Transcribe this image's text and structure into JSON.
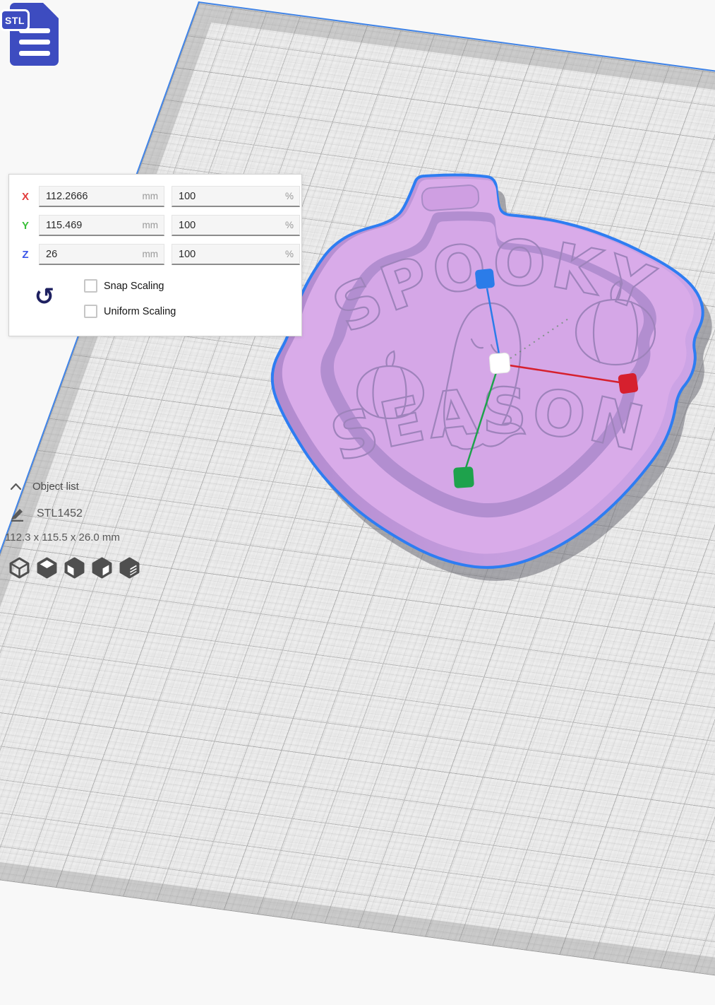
{
  "viewport": {
    "background": "#f8f8f8",
    "plate_edge_color": "#3e83e8",
    "grid_major_color": "#bfbfbf"
  },
  "file_badge": {
    "label": "STL",
    "color": "#3d4cc0",
    "icon": "stl-file-icon"
  },
  "scale_panel": {
    "rows": [
      {
        "axis": "X",
        "axis_color": "#e23b3b",
        "value": "112.2666",
        "unit": "mm",
        "percent": "100",
        "percent_unit": "%"
      },
      {
        "axis": "Y",
        "axis_color": "#38bf38",
        "value": "115.469",
        "unit": "mm",
        "percent": "100",
        "percent_unit": "%"
      },
      {
        "axis": "Z",
        "axis_color": "#3a55e8",
        "value": "26",
        "unit": "mm",
        "percent": "100",
        "percent_unit": "%"
      }
    ],
    "reset_icon": "reset-scale-icon",
    "reset_glyph": "↺",
    "checkboxes": [
      {
        "label": "Snap Scaling",
        "checked": false
      },
      {
        "label": "Uniform Scaling",
        "checked": false
      }
    ]
  },
  "object_info": {
    "object_list_label": "Object list",
    "object_list_icon": "chevron-up-icon",
    "object_name": "STL1452",
    "object_name_icon": "pencil-icon",
    "dimensions": "112.3 x 115.5 x 26.0 mm"
  },
  "view_toolbar": {
    "icons": [
      "view-3d",
      "view-front",
      "view-top",
      "view-left",
      "view-right"
    ]
  },
  "model": {
    "text_top": "SPOOKY",
    "text_bottom": "SEASON",
    "design_elements": [
      "ghost",
      "pumpkin-left",
      "pumpkin-right",
      "hanger-tab"
    ],
    "colors": {
      "body": "#c59dde",
      "top_face": "#d9abe9",
      "inner_wall": "#b28ed0",
      "floor": "#d5a7e7",
      "engraving": "#9e83bb",
      "selection_outline": "#2e7df2"
    },
    "handles": {
      "x_color": "#d6202e",
      "y_color": "#1ea24c",
      "z_color": "#2b7ce9",
      "center_color": "#ffffff"
    }
  }
}
